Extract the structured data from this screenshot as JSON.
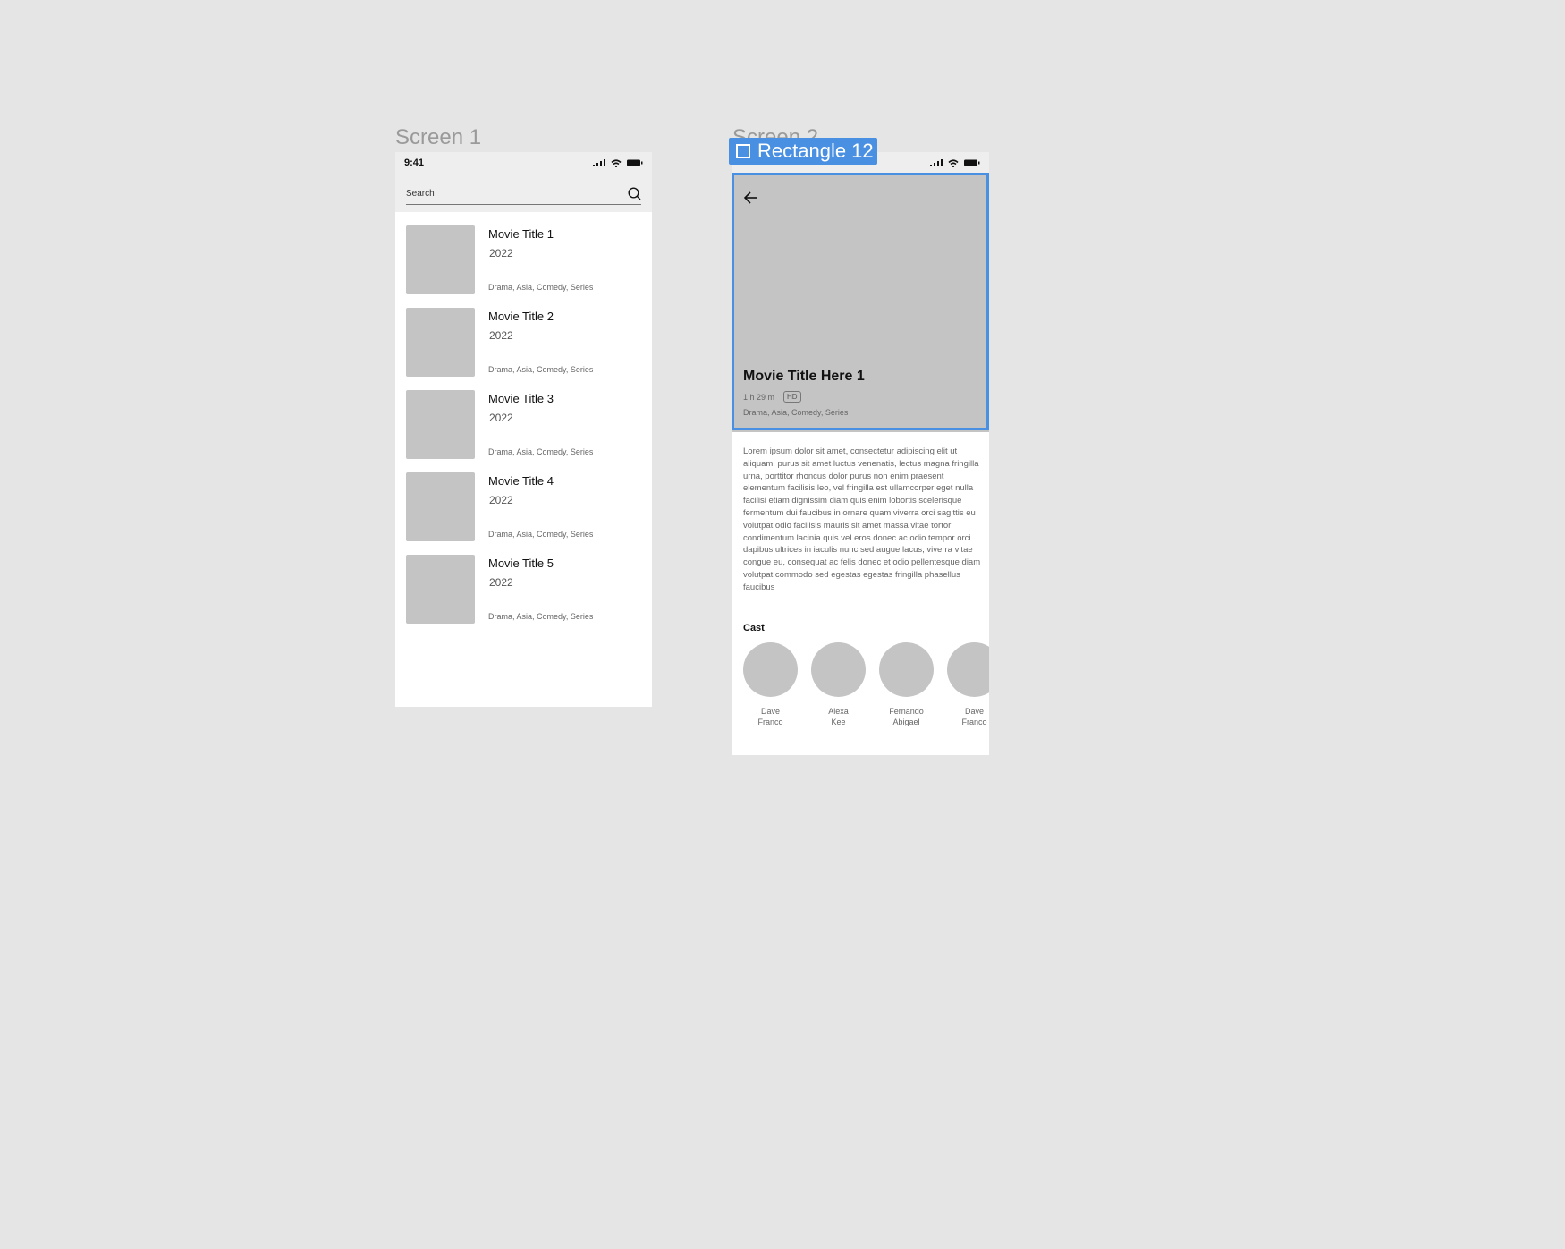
{
  "canvas": {
    "background": "#e5e5e5",
    "selection_color": "#4a90e2"
  },
  "screen1": {
    "label": "Screen 1",
    "status_time": "9:41",
    "search": {
      "placeholder": "Search",
      "icon": "search-icon"
    },
    "movies": [
      {
        "title": "Movie Title 1",
        "year": "2022",
        "genres": "Drama, Asia, Comedy, Series"
      },
      {
        "title": "Movie Title 2",
        "year": "2022",
        "genres": "Drama, Asia, Comedy, Series"
      },
      {
        "title": "Movie Title 3",
        "year": "2022",
        "genres": "Drama, Asia, Comedy, Series"
      },
      {
        "title": "Movie Title 4",
        "year": "2022",
        "genres": "Drama, Asia, Comedy, Series"
      },
      {
        "title": "Movie Title 5",
        "year": "2022",
        "genres": "Drama, Asia, Comedy, Series"
      }
    ]
  },
  "screen2": {
    "label": "Screen 2",
    "selection_tag": "Rectangle 12",
    "hero": {
      "title": "Movie Title Here 1",
      "duration": "1 h 29 m",
      "badge": "HD",
      "genres": "Drama, Asia, Comedy, Series"
    },
    "description": "Lorem ipsum dolor sit amet, consectetur adipiscing elit ut aliquam, purus sit amet luctus venenatis, lectus magna fringilla urna, porttitor rhoncus dolor purus non enim praesent elementum facilisis leo, vel fringilla est ullamcorper eget nulla facilisi etiam dignissim diam quis enim lobortis scelerisque fermentum dui faucibus in ornare quam viverra orci sagittis eu volutpat odio facilisis mauris sit amet massa vitae tortor condimentum lacinia quis vel eros donec ac odio tempor orci dapibus ultrices in iaculis nunc sed augue lacus, viverra vitae congue eu, consequat ac felis donec et odio pellentesque diam volutpat commodo sed egestas egestas fringilla phasellus faucibus",
    "cast_heading": "Cast",
    "cast": [
      {
        "first": "Dave",
        "last": "Franco"
      },
      {
        "first": "Alexa",
        "last": "Kee"
      },
      {
        "first": "Fernando",
        "last": "Abigael"
      },
      {
        "first": "Dave",
        "last": "Franco"
      }
    ]
  }
}
